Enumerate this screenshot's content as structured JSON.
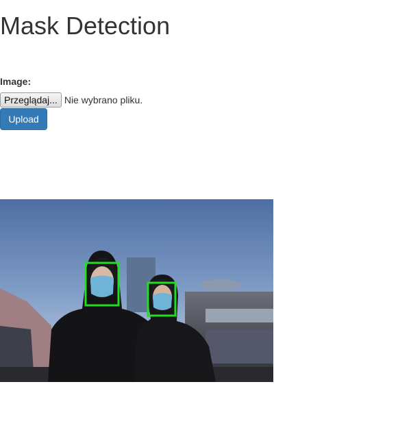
{
  "header": {
    "title": "Mask Detection"
  },
  "form": {
    "image_label": "Image:",
    "browse_label": "Przeglądaj...",
    "file_status": "Nie wybrano pliku.",
    "upload_label": "Upload"
  },
  "result": {
    "detections": [
      {
        "label": "face-with-mask",
        "color": "#22dd22"
      },
      {
        "label": "face-with-mask",
        "color": "#22dd22"
      }
    ]
  },
  "colors": {
    "primary_button": "#337ab7",
    "detection_box": "#22dd22"
  }
}
